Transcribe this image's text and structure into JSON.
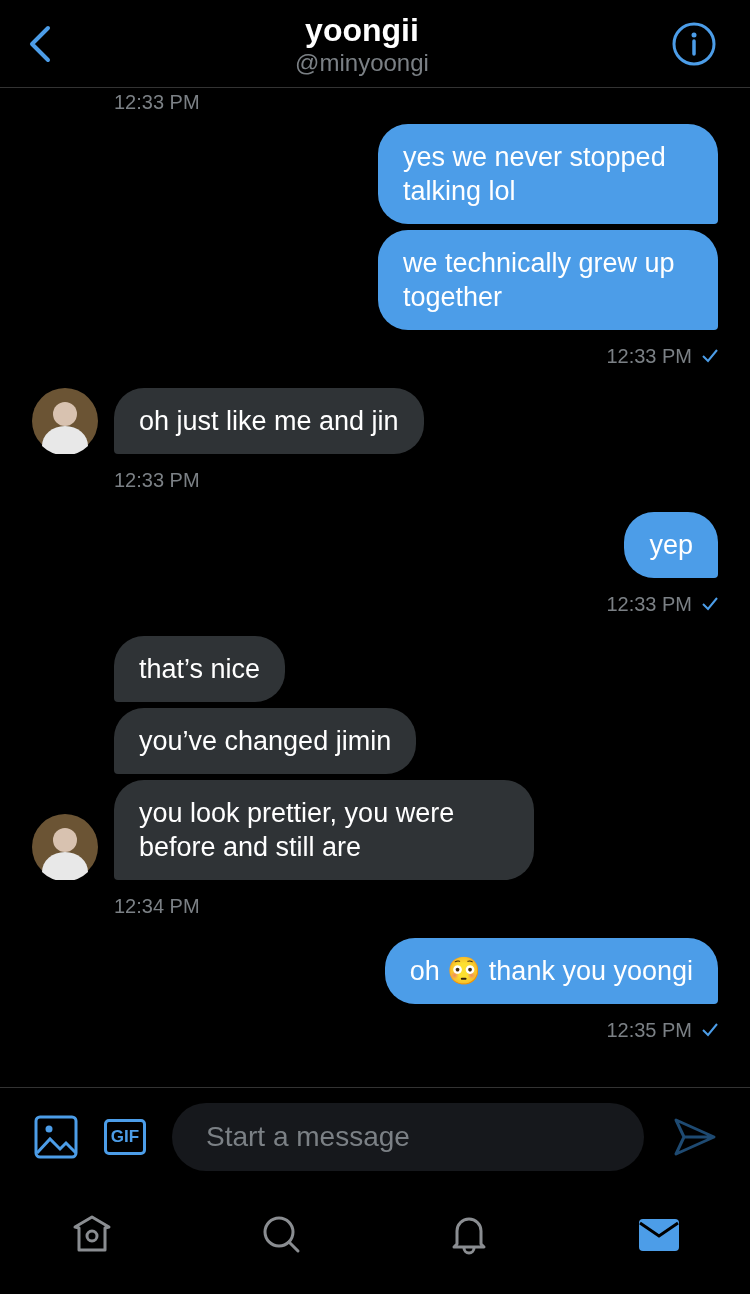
{
  "header": {
    "name": "yoongii",
    "handle": "@minyoongi"
  },
  "messages": [
    {
      "kind": "stamp",
      "time": "12:33 PM"
    },
    {
      "kind": "sent",
      "bubbles": [
        "yes we never stopped talking lol",
        "we technically grew up together"
      ],
      "time": "12:33 PM",
      "read": true
    },
    {
      "kind": "received",
      "bubbles": [
        "oh just like me and jin"
      ],
      "time": "12:33 PM"
    },
    {
      "kind": "sent",
      "bubbles": [
        "yep"
      ],
      "time": "12:33 PM",
      "read": true
    },
    {
      "kind": "received",
      "bubbles": [
        "that’s nice",
        "you’ve changed jimin",
        "you look prettier, you were before and still are"
      ],
      "time": "12:34 PM"
    },
    {
      "kind": "sent",
      "bubbles": [
        "oh 😳 thank you yoongi"
      ],
      "time": "12:35 PM",
      "read": true
    }
  ],
  "composer": {
    "gif": "GIF",
    "placeholder": "Start a message"
  },
  "nav": [
    {
      "kind": "home",
      "selected": false
    },
    {
      "kind": "search",
      "selected": false
    },
    {
      "kind": "notifications",
      "selected": false
    },
    {
      "kind": "messages",
      "selected": true
    }
  ]
}
